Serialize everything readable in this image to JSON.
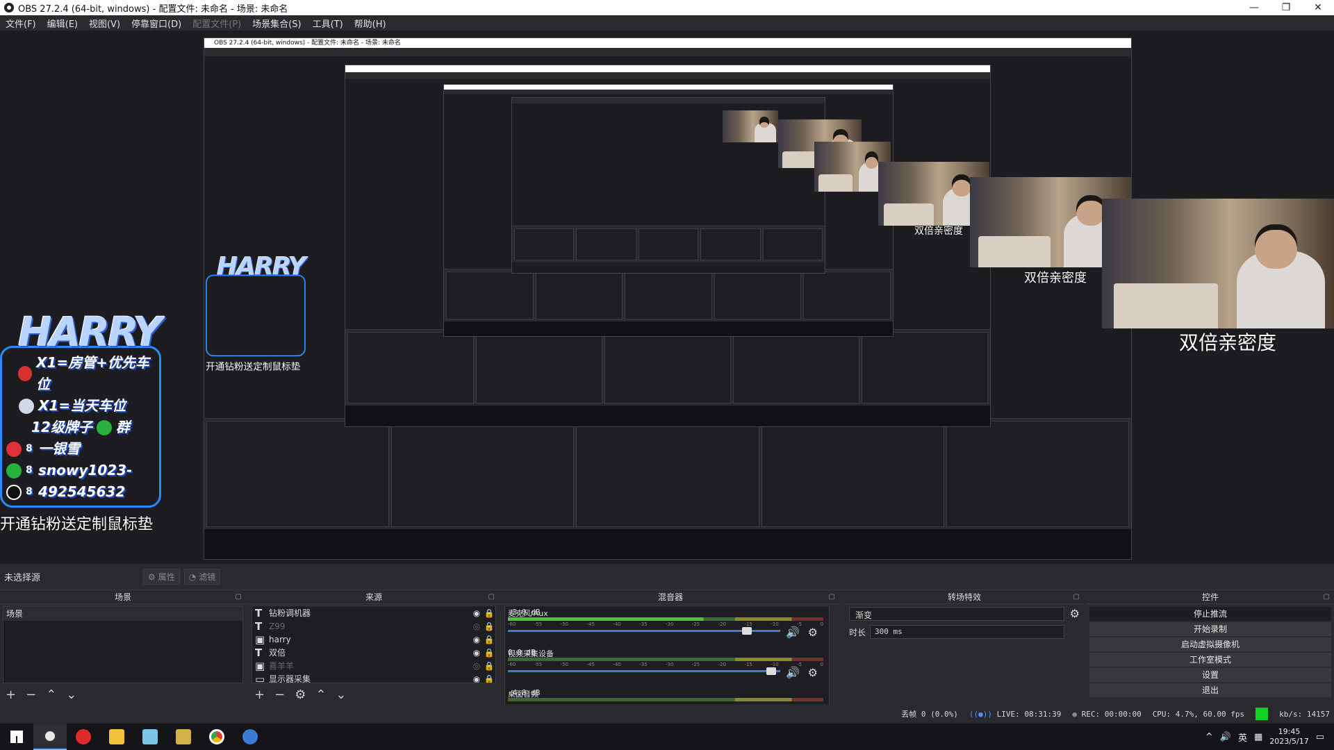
{
  "window": {
    "title": "OBS 27.2.4 (64-bit, windows) - 配置文件: 未命名 - 场景: 未命名"
  },
  "window_controls": {
    "minimize": "—",
    "restore": "❐",
    "close": "✕"
  },
  "menu": [
    "文件(F)",
    "编辑(E)",
    "视图(V)",
    "停靠窗口(D)",
    "配置文件(P)",
    "场景集合(S)",
    "工具(T)",
    "帮助(H)"
  ],
  "preview": {
    "overlay": {
      "brand": "HARRY",
      "lines": [
        {
          "num": "",
          "text": "X1=房管+优先车位",
          "icon": "badge-icon",
          "color": "#d93030"
        },
        {
          "num": "",
          "text": "X1=当天车位",
          "icon": "plane-icon",
          "color": "#d0d8e8"
        },
        {
          "num": "",
          "text": "12级牌子",
          "icon": "",
          "color": ""
        },
        {
          "num": "8",
          "text": "一银雪",
          "icon": "weibo-icon",
          "color": "#e0303a"
        },
        {
          "num": "8",
          "text": "snowy1023-",
          "icon": "wechat-icon",
          "color": "#27b33b"
        },
        {
          "num": "8",
          "text": "492545632",
          "icon": "qq-icon",
          "color": "#111111"
        }
      ],
      "group_suffix": "群",
      "footer": "开通钻粉送定制鼠标垫"
    },
    "caption": "双倍亲密度"
  },
  "selection_bar": {
    "label": "未选择源",
    "properties": "属性",
    "filters": "滤镜"
  },
  "docks": {
    "scenes": {
      "title": "场景",
      "items": [
        "场景"
      ]
    },
    "sources": {
      "title": "来源",
      "items": [
        {
          "icon": "T",
          "name": "钻粉调机器",
          "visible": true
        },
        {
          "icon": "T",
          "name": "Z99",
          "visible": false
        },
        {
          "icon": "▣",
          "name": "harry",
          "visible": true
        },
        {
          "icon": "T",
          "name": "双倍",
          "visible": true
        },
        {
          "icon": "▣",
          "name": "喜羊羊",
          "visible": false
        },
        {
          "icon": "▭",
          "name": "显示器采集",
          "visible": true
        }
      ]
    },
    "mixer": {
      "title": "混音器",
      "channels": [
        {
          "name": "麦克风/Aux",
          "db": "-3.0 dB",
          "slider": 0.88,
          "level": 0.62
        },
        {
          "name": "视频采集设备",
          "db": "0.0 dB",
          "slider": 0.97,
          "level": 0.0
        },
        {
          "name": "桌面音频",
          "db": "-4.8 dB",
          "slider": 0.8,
          "level": 0.0
        }
      ],
      "scale": [
        "-60",
        "-55",
        "-50",
        "-45",
        "-40",
        "-35",
        "-30",
        "-25",
        "-20",
        "-15",
        "-10",
        "-5",
        "0"
      ]
    },
    "transitions": {
      "title": "转场特效",
      "selected": "渐变",
      "duration_label": "时长",
      "duration": "300 ms"
    },
    "controls": {
      "title": "控件",
      "buttons": [
        "停止推流",
        "开始录制",
        "启动虚拟摄像机",
        "工作室模式",
        "设置",
        "退出"
      ]
    }
  },
  "status": {
    "dropped": "丢帧 0 (0.0%)",
    "live": "LIVE: 08:31:39",
    "rec": "REC: 00:00:00",
    "cpu": "CPU: 4.7%, 60.00 fps",
    "bitrate": "kb/s: 14157"
  },
  "taskbar": {
    "apps": [
      {
        "name": "start-icon",
        "color": "#ffffff"
      },
      {
        "name": "obs-icon",
        "color": "#e8e8e8"
      },
      {
        "name": "netease-icon",
        "color": "#e02a2a"
      },
      {
        "name": "folder-icon",
        "color": "#f2c33a"
      },
      {
        "name": "notes-icon",
        "color": "#7cc4e8"
      },
      {
        "name": "game-icon",
        "color": "#d4b24a"
      },
      {
        "name": "chrome-icon",
        "color": "#f2b600"
      },
      {
        "name": "steam-icon",
        "color": "#3a7bd5"
      }
    ],
    "tray": {
      "ime": "英",
      "time": "19:45",
      "date": "2023/5/17"
    }
  }
}
